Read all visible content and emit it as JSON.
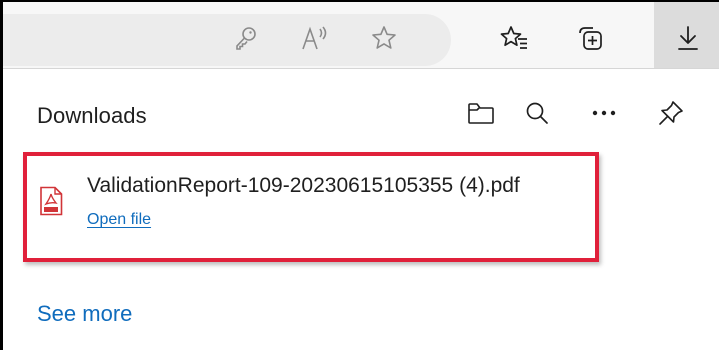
{
  "browser_toolbar": {
    "icons": [
      "key-icon",
      "read-aloud-icon",
      "favorite-star-icon",
      "favorites-list-icon",
      "collections-icon",
      "downloads-icon"
    ]
  },
  "downloads_panel": {
    "title": "Downloads",
    "header_icons": [
      "open-folder-icon",
      "search-icon",
      "more-options-icon",
      "pin-icon"
    ],
    "items": [
      {
        "file_name": "ValidationReport-109-20230615105355 (4).pdf",
        "action_label": "Open file",
        "file_icon": "pdf-icon"
      }
    ],
    "see_more_label": "See more"
  },
  "colors": {
    "link": "#0f6cbd",
    "highlight_border": "#e0203a",
    "pdf_red": "#d13438",
    "toolbar_bg": "#f7f7f7"
  }
}
